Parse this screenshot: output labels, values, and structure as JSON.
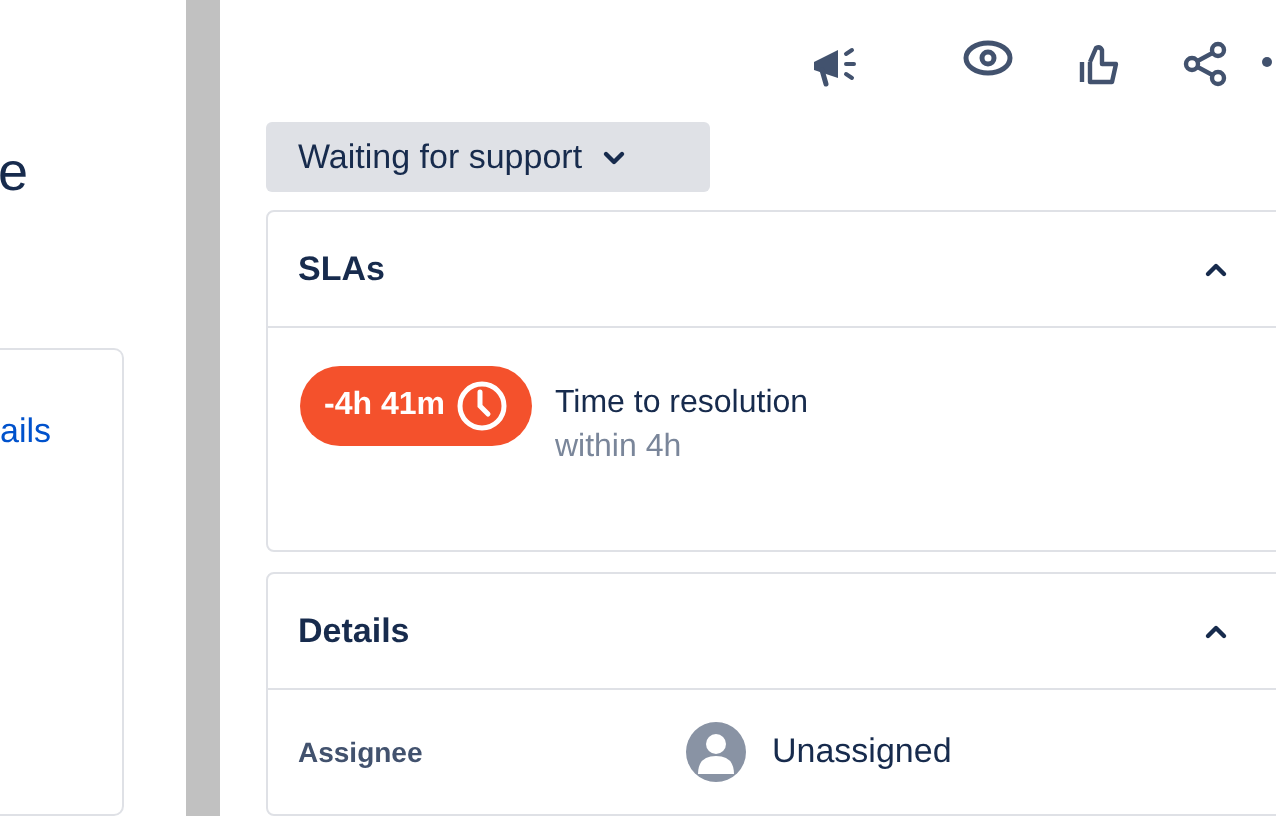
{
  "left_panel": {
    "heading": "e",
    "link": "ails"
  },
  "status": {
    "label": "Waiting for support"
  },
  "sla_section": {
    "title": "SLAs",
    "expanded": true,
    "items": [
      {
        "badge": "-4h 41m",
        "name": "Time to resolution",
        "goal": "within 4h",
        "breached": true
      }
    ]
  },
  "details_section": {
    "title": "Details",
    "expanded": true,
    "fields": [
      {
        "label": "Assignee",
        "value": "Unassigned"
      }
    ]
  }
}
